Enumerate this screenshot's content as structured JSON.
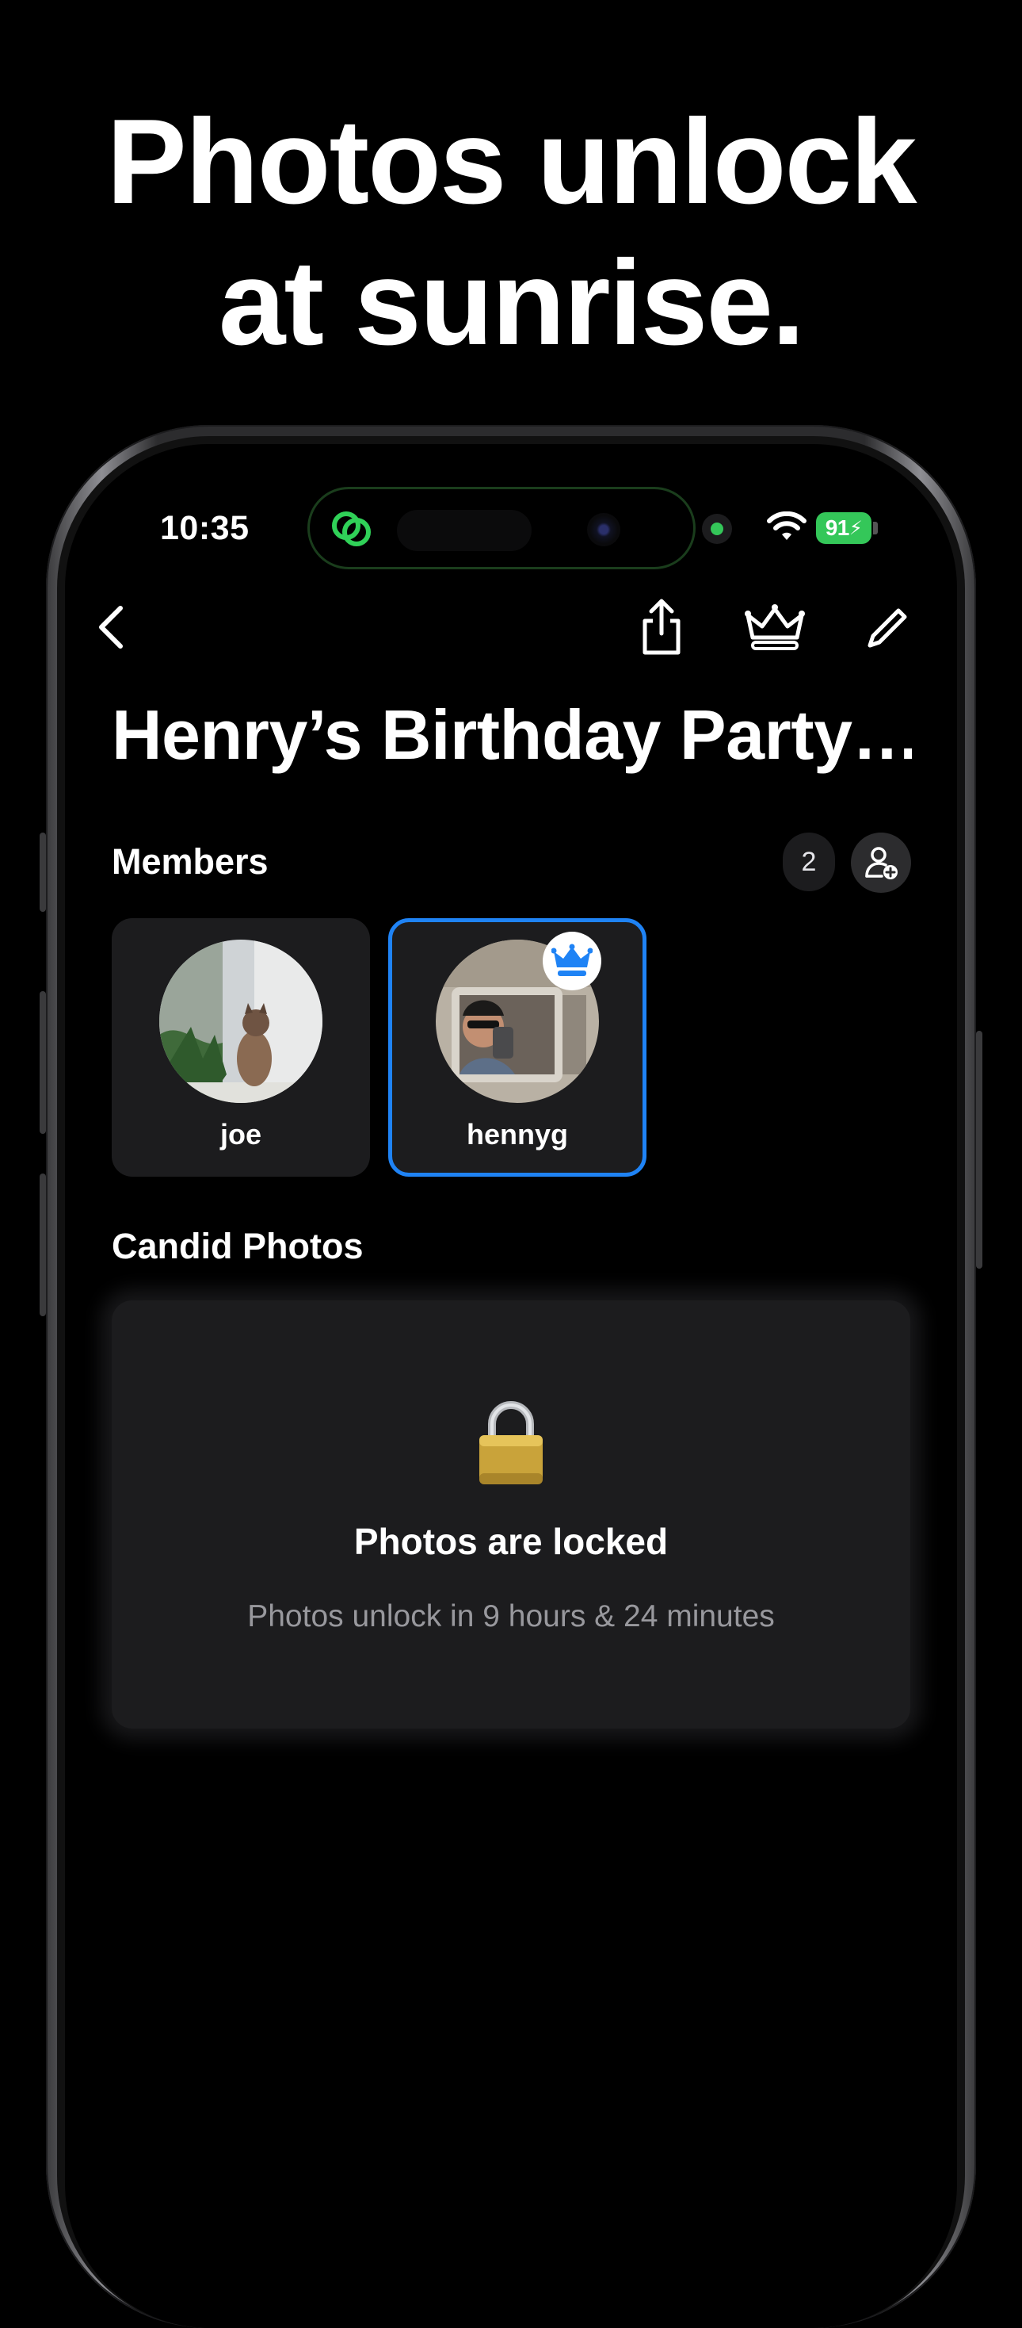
{
  "headline": {
    "line1": "Photos unlock",
    "line2": "at sunrise."
  },
  "status_bar": {
    "time": "10:35",
    "battery": "91"
  },
  "nav": {
    "icons": [
      "chevron-left-icon",
      "share-icon",
      "crown-icon",
      "pencil-icon"
    ]
  },
  "page": {
    "title": "Henry’s Birthday Party…"
  },
  "members": {
    "title": "Members",
    "count": "2",
    "list": [
      {
        "name": "joe",
        "owner": false
      },
      {
        "name": "hennyg",
        "owner": true
      }
    ]
  },
  "candid": {
    "title": "Candid Photos",
    "locked_title": "Photos are locked",
    "locked_subtitle": "Photos unlock in 9 hours & 24 minutes"
  },
  "colors": {
    "accent": "#1f83f5",
    "battery": "#34c759",
    "background": "#000000",
    "card": "#1c1c1e"
  }
}
